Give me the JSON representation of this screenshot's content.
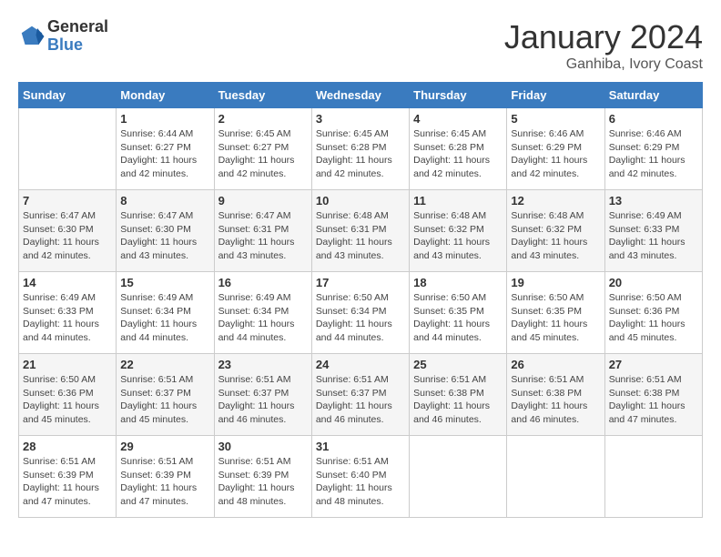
{
  "header": {
    "logo_general": "General",
    "logo_blue": "Blue",
    "month": "January 2024",
    "location": "Ganhiba, Ivory Coast"
  },
  "days_of_week": [
    "Sunday",
    "Monday",
    "Tuesday",
    "Wednesday",
    "Thursday",
    "Friday",
    "Saturday"
  ],
  "weeks": [
    [
      {
        "day": "",
        "info": ""
      },
      {
        "day": "1",
        "info": "Sunrise: 6:44 AM\nSunset: 6:27 PM\nDaylight: 11 hours\nand 42 minutes."
      },
      {
        "day": "2",
        "info": "Sunrise: 6:45 AM\nSunset: 6:27 PM\nDaylight: 11 hours\nand 42 minutes."
      },
      {
        "day": "3",
        "info": "Sunrise: 6:45 AM\nSunset: 6:28 PM\nDaylight: 11 hours\nand 42 minutes."
      },
      {
        "day": "4",
        "info": "Sunrise: 6:45 AM\nSunset: 6:28 PM\nDaylight: 11 hours\nand 42 minutes."
      },
      {
        "day": "5",
        "info": "Sunrise: 6:46 AM\nSunset: 6:29 PM\nDaylight: 11 hours\nand 42 minutes."
      },
      {
        "day": "6",
        "info": "Sunrise: 6:46 AM\nSunset: 6:29 PM\nDaylight: 11 hours\nand 42 minutes."
      }
    ],
    [
      {
        "day": "7",
        "info": "Sunrise: 6:47 AM\nSunset: 6:30 PM\nDaylight: 11 hours\nand 42 minutes."
      },
      {
        "day": "8",
        "info": "Sunrise: 6:47 AM\nSunset: 6:30 PM\nDaylight: 11 hours\nand 43 minutes."
      },
      {
        "day": "9",
        "info": "Sunrise: 6:47 AM\nSunset: 6:31 PM\nDaylight: 11 hours\nand 43 minutes."
      },
      {
        "day": "10",
        "info": "Sunrise: 6:48 AM\nSunset: 6:31 PM\nDaylight: 11 hours\nand 43 minutes."
      },
      {
        "day": "11",
        "info": "Sunrise: 6:48 AM\nSunset: 6:32 PM\nDaylight: 11 hours\nand 43 minutes."
      },
      {
        "day": "12",
        "info": "Sunrise: 6:48 AM\nSunset: 6:32 PM\nDaylight: 11 hours\nand 43 minutes."
      },
      {
        "day": "13",
        "info": "Sunrise: 6:49 AM\nSunset: 6:33 PM\nDaylight: 11 hours\nand 43 minutes."
      }
    ],
    [
      {
        "day": "14",
        "info": "Sunrise: 6:49 AM\nSunset: 6:33 PM\nDaylight: 11 hours\nand 44 minutes."
      },
      {
        "day": "15",
        "info": "Sunrise: 6:49 AM\nSunset: 6:34 PM\nDaylight: 11 hours\nand 44 minutes."
      },
      {
        "day": "16",
        "info": "Sunrise: 6:49 AM\nSunset: 6:34 PM\nDaylight: 11 hours\nand 44 minutes."
      },
      {
        "day": "17",
        "info": "Sunrise: 6:50 AM\nSunset: 6:34 PM\nDaylight: 11 hours\nand 44 minutes."
      },
      {
        "day": "18",
        "info": "Sunrise: 6:50 AM\nSunset: 6:35 PM\nDaylight: 11 hours\nand 44 minutes."
      },
      {
        "day": "19",
        "info": "Sunrise: 6:50 AM\nSunset: 6:35 PM\nDaylight: 11 hours\nand 45 minutes."
      },
      {
        "day": "20",
        "info": "Sunrise: 6:50 AM\nSunset: 6:36 PM\nDaylight: 11 hours\nand 45 minutes."
      }
    ],
    [
      {
        "day": "21",
        "info": "Sunrise: 6:50 AM\nSunset: 6:36 PM\nDaylight: 11 hours\nand 45 minutes."
      },
      {
        "day": "22",
        "info": "Sunrise: 6:51 AM\nSunset: 6:37 PM\nDaylight: 11 hours\nand 45 minutes."
      },
      {
        "day": "23",
        "info": "Sunrise: 6:51 AM\nSunset: 6:37 PM\nDaylight: 11 hours\nand 46 minutes."
      },
      {
        "day": "24",
        "info": "Sunrise: 6:51 AM\nSunset: 6:37 PM\nDaylight: 11 hours\nand 46 minutes."
      },
      {
        "day": "25",
        "info": "Sunrise: 6:51 AM\nSunset: 6:38 PM\nDaylight: 11 hours\nand 46 minutes."
      },
      {
        "day": "26",
        "info": "Sunrise: 6:51 AM\nSunset: 6:38 PM\nDaylight: 11 hours\nand 46 minutes."
      },
      {
        "day": "27",
        "info": "Sunrise: 6:51 AM\nSunset: 6:38 PM\nDaylight: 11 hours\nand 47 minutes."
      }
    ],
    [
      {
        "day": "28",
        "info": "Sunrise: 6:51 AM\nSunset: 6:39 PM\nDaylight: 11 hours\nand 47 minutes."
      },
      {
        "day": "29",
        "info": "Sunrise: 6:51 AM\nSunset: 6:39 PM\nDaylight: 11 hours\nand 47 minutes."
      },
      {
        "day": "30",
        "info": "Sunrise: 6:51 AM\nSunset: 6:39 PM\nDaylight: 11 hours\nand 48 minutes."
      },
      {
        "day": "31",
        "info": "Sunrise: 6:51 AM\nSunset: 6:40 PM\nDaylight: 11 hours\nand 48 minutes."
      },
      {
        "day": "",
        "info": ""
      },
      {
        "day": "",
        "info": ""
      },
      {
        "day": "",
        "info": ""
      }
    ]
  ]
}
